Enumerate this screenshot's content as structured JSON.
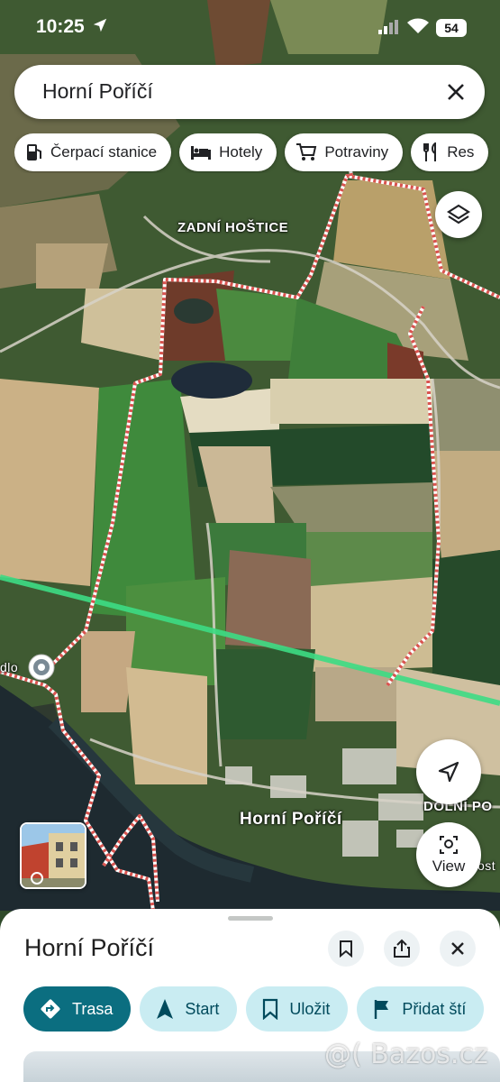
{
  "status_bar": {
    "time": "10:25",
    "battery": "54"
  },
  "search": {
    "query": "Horní Poříčí"
  },
  "chips": [
    {
      "label": "Čerpací stanice",
      "icon": "gas-station-icon"
    },
    {
      "label": "Hotely",
      "icon": "bed-icon"
    },
    {
      "label": "Potraviny",
      "icon": "cart-icon"
    },
    {
      "label": "Res",
      "icon": "restaurant-icon"
    }
  ],
  "map": {
    "labels": {
      "zadni_hostice": "ZADNÍ HOŠTICE",
      "horni_porici": "Horní Poříčí",
      "dolni_po": "DOLNÍ PO",
      "left_cut": "dlo",
      "right_cut": "ost"
    },
    "view_button": "View"
  },
  "sheet": {
    "title": "Horní Poříčí",
    "actions": [
      {
        "label": "Trasa",
        "icon": "directions-icon"
      },
      {
        "label": "Start",
        "icon": "navigation-arrow-icon"
      },
      {
        "label": "Uložit",
        "icon": "bookmark-icon"
      },
      {
        "label": "Přidat ští",
        "icon": "flag-icon"
      }
    ]
  },
  "watermark": "@( Bazos.cz",
  "colors": {
    "accent": "#0b6e80",
    "chip_bg": "#c9ecf2",
    "route_green": "#3ddc84",
    "boundary": "#f4c7c3"
  }
}
